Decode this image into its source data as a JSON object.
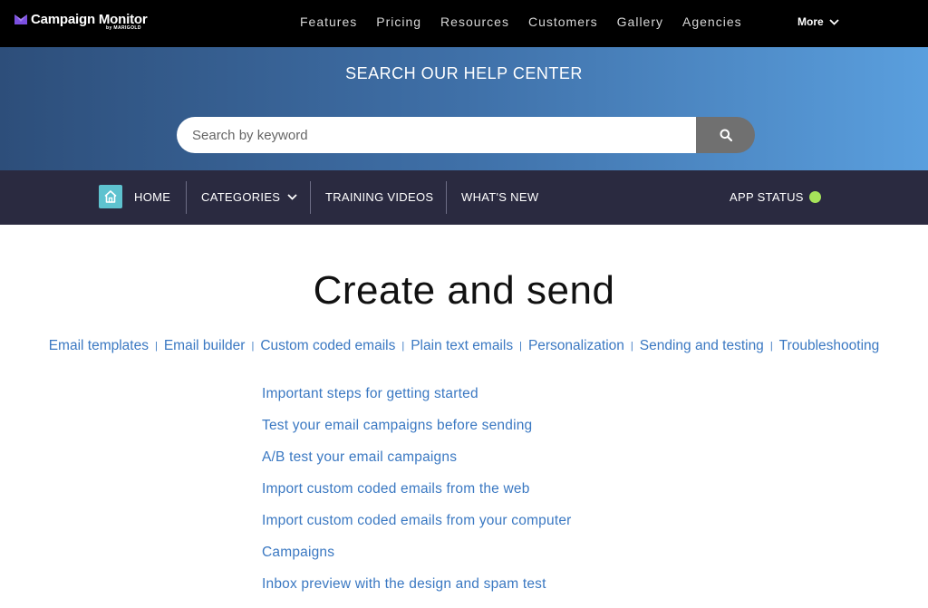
{
  "brand": {
    "name": "Campaign Monitor",
    "sub": "by MARIGOLD",
    "icon": "campaign-monitor-logo-icon",
    "accent": "#7b4fe0"
  },
  "top_nav": {
    "links": [
      "Features",
      "Pricing",
      "Resources",
      "Customers",
      "Gallery",
      "Agencies"
    ],
    "more_label": "More"
  },
  "hero": {
    "title": "SEARCH OUR HELP CENTER",
    "search_placeholder": "Search by keyword",
    "search_value": ""
  },
  "sub_nav": {
    "home_label": "HOME",
    "categories_label": "CATEGORIES",
    "training_label": "TRAINING VIDEOS",
    "whats_new_label": "WHAT'S NEW",
    "app_status_label": "APP STATUS",
    "status_color": "#a6e35a"
  },
  "main": {
    "title": "Create and send",
    "categories": [
      "Email templates",
      "Email builder",
      "Custom coded emails",
      "Plain text emails",
      "Personalization",
      "Sending and testing",
      "Troubleshooting"
    ],
    "articles": [
      "Important steps for getting started",
      "Test your email campaigns before sending",
      "A/B test your email campaigns",
      "Import custom coded emails from the web",
      "Import custom coded emails from your computer",
      "Campaigns",
      "Inbox preview with the design and spam test"
    ]
  }
}
